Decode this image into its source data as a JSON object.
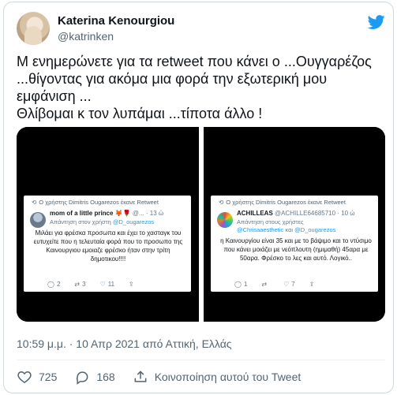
{
  "author": {
    "name": "Katerina Kenourgiou",
    "handle": "@katrinken"
  },
  "tweet": {
    "text": "Μ ενημερώνετε για τα retweet που κάνει ο ...Ουγγαρέζος\n...θίγοντας για ακόμα μια φορά την εξωτερική μου\nεμφάνιση ...\nΘλίβομαι κ τον λυπάμαι ...τίποτα άλλο !",
    "timestamp": "10:59 μ.μ. · 10 Απρ 2021 από Αττική, Ελλάς"
  },
  "media": {
    "left": {
      "retweet_line": "Ο χρήστης Dimitris Ougarezos έκανε Retweet",
      "name": "mom of a little prince",
      "emoji": "🦊🌹",
      "meta": "@... · 13 ώ",
      "reply_prefix": "Απάντηση στον χρήστη",
      "reply_mention": "@D_ougarezos",
      "body": "Μιλάει για φρέσκα προσωπα και έχει το χασταγκ του ευτυχείτε που η τελευταία φορά που το προσωπο της Καινουργιου εμοιαζε φρέσκο ήταν στην τρίτη δημοτικου!!!!",
      "replies": "2",
      "retweets": "3",
      "likes": "11"
    },
    "right": {
      "retweet_line": "Ο χρήστης Dimitris Ougarezos έκανε Retweet",
      "name": "ACHILLEAS",
      "meta": "@ACHILLE64685710 · 10 ώ",
      "reply_prefix": "Απάντηση στους χρήστες",
      "reply_mention_1": "@Chrisaaesthetic",
      "reply_and": "και",
      "reply_mention_2": "@D_ougarezos",
      "body": "η Καινουργίου είναι 35 και με το βάψιμο και το ντύσιμο που κάνει μοιάζει με νεόπλουτη (ημιμαθή) 45αρα με 50αρα. Φρέσκο το λες και αυτό. Λογικό..",
      "replies": "1",
      "retweets": "",
      "likes": "7"
    }
  },
  "actions": {
    "likes": "725",
    "replies": "168",
    "share_label": "Κοινοποίηση αυτού του Tweet"
  },
  "colors": {
    "twitter_blue": "#1d9bf0",
    "like_red": "#f91880",
    "text_secondary": "#536471"
  },
  "icons": [
    "twitter-bird-icon",
    "heart-icon",
    "comment-icon",
    "share-icon",
    "retweet-icon"
  ]
}
